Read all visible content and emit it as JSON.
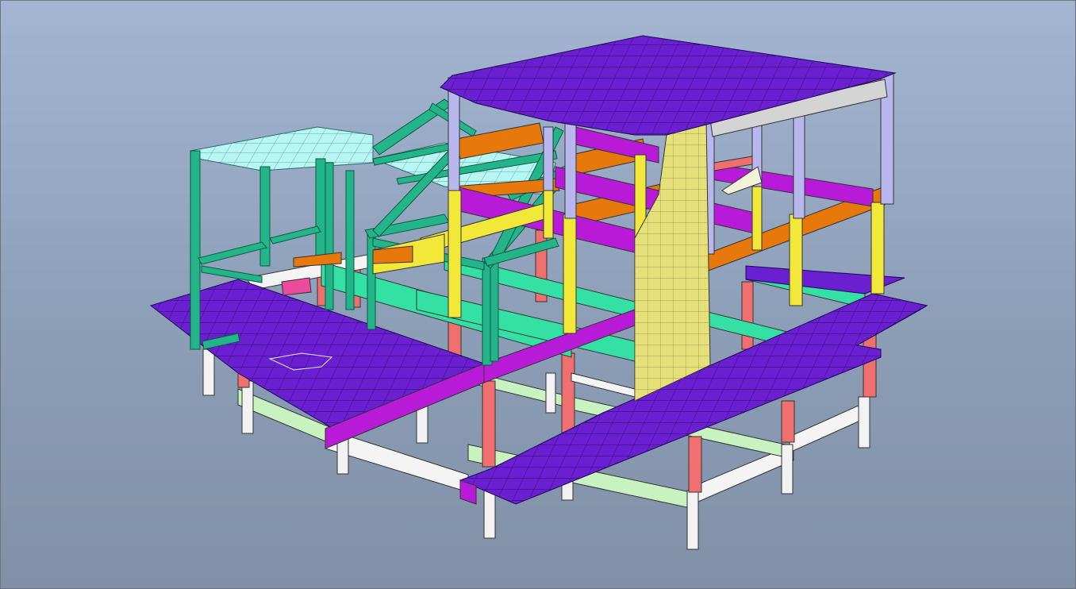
{
  "viewport": {
    "background_top": "#a3b5d1",
    "background_bottom": "#7f90a7",
    "colors": {
      "roof_slab": "#6a1fd1",
      "mesh_line": "#2a0a66",
      "column_lavender": "#b8b8ee",
      "column_yellow": "#f2e83a",
      "column_red": "#f07070",
      "column_white": "#f2f2f2",
      "beam_orange": "#e6780c",
      "beam_magenta": "#b81bd8",
      "beam_mint": "#34e0a4",
      "beam_pale_green": "#c8f2c0",
      "truss_green": "#23b48a",
      "cyan_slab": "#b8f6f4",
      "shear_wall": "#e6e07a",
      "grey_beam": "#d4d4d4"
    }
  }
}
